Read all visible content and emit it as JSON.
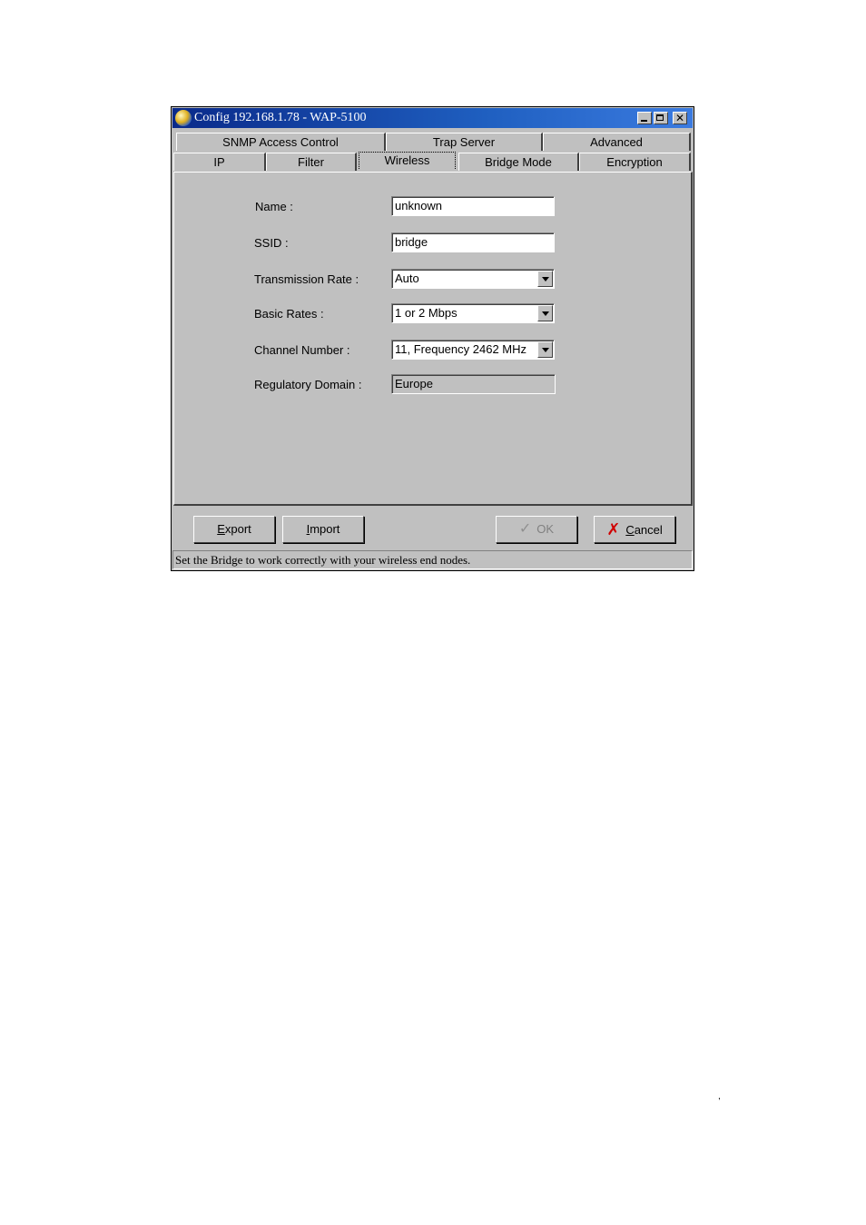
{
  "window": {
    "title": "Config 192.168.1.78 - WAP-5100"
  },
  "tabs": {
    "row1": [
      "SNMP Access Control",
      "Trap Server",
      "Advanced"
    ],
    "row2": [
      "IP",
      "Filter",
      "Wireless",
      "Bridge Mode",
      "Encryption"
    ],
    "active": "Wireless"
  },
  "form": {
    "name": {
      "label": "Name :",
      "value": "unknown"
    },
    "ssid": {
      "label": "SSID :",
      "value": "bridge"
    },
    "transmission_rate": {
      "label": "Transmission Rate :",
      "value": "Auto"
    },
    "basic_rates": {
      "label": "Basic Rates :",
      "value": "1 or 2 Mbps"
    },
    "channel_number": {
      "label": "Channel Number :",
      "value": "11, Frequency 2462 MHz"
    },
    "regulatory_domain": {
      "label": "Regulatory Domain :",
      "value": "Europe"
    }
  },
  "buttons": {
    "export_first": "E",
    "export_rest": "xport",
    "import_first": "I",
    "import_rest": "mport",
    "ok": "OK",
    "cancel_first": "C",
    "cancel_rest": "ancel"
  },
  "status": {
    "text": "Set the Bridge to work correctly with your wireless end nodes."
  },
  "page": {
    "stray_mark": ","
  }
}
